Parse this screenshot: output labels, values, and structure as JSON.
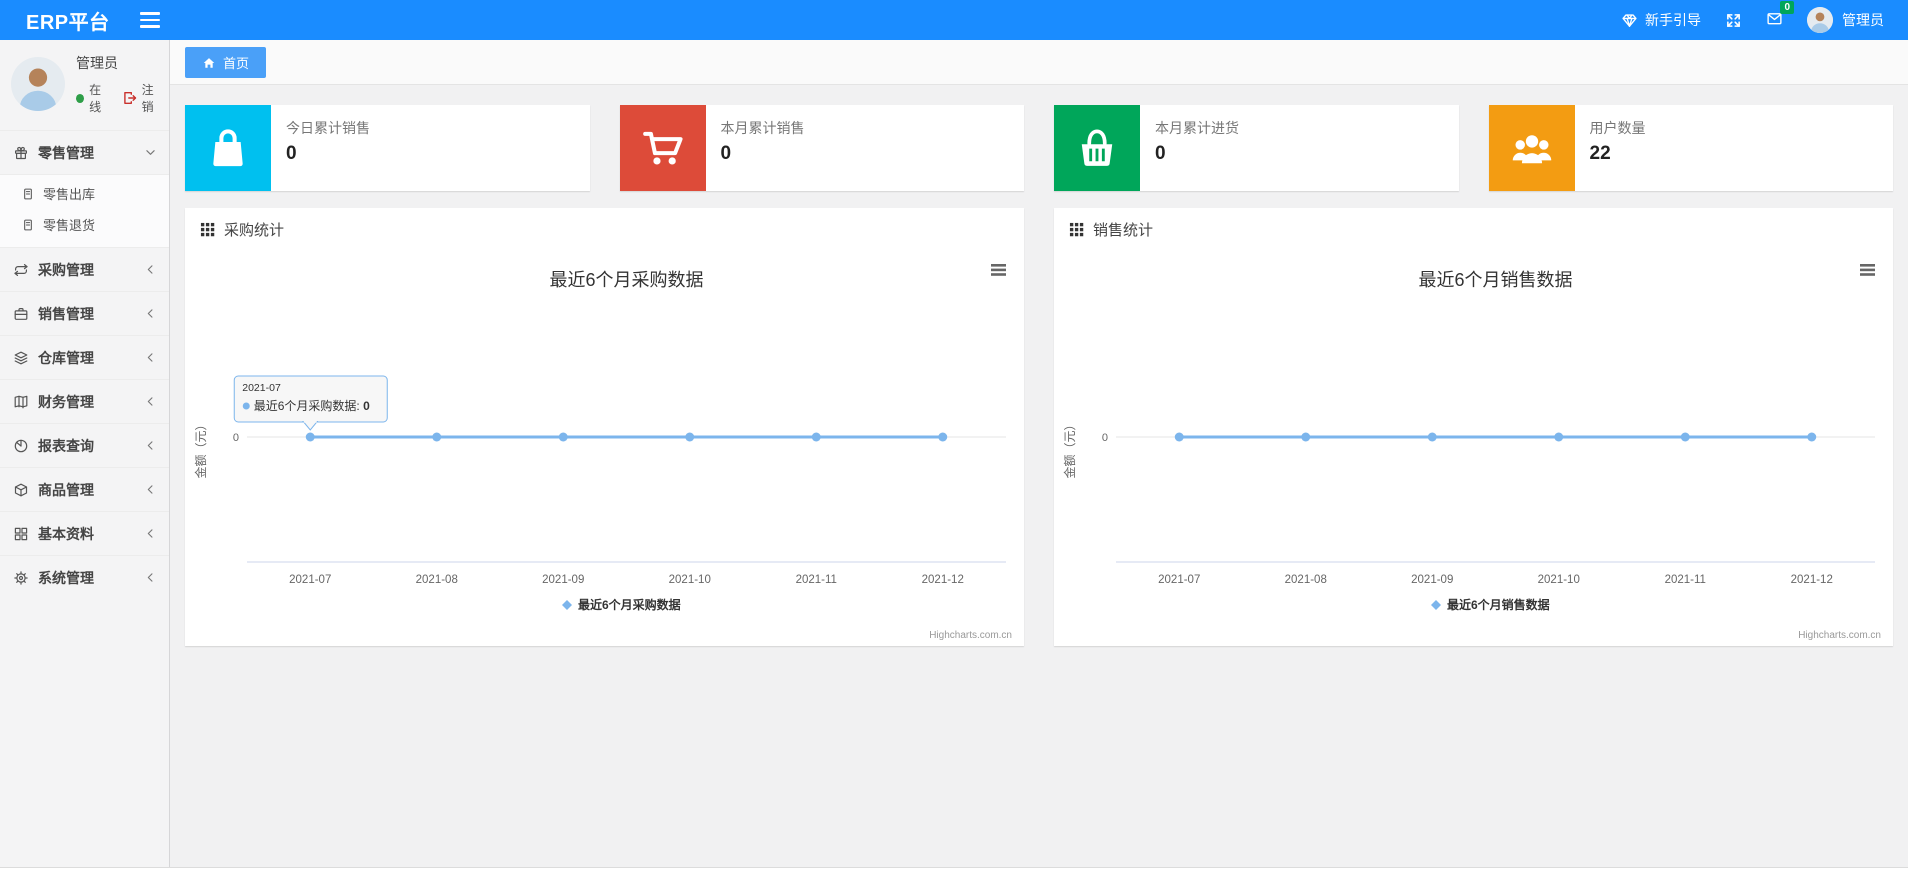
{
  "theme": {
    "navbar_blue": "#1a8cff",
    "tab_active_blue": "#4aa0f8",
    "badge_green": "#00a65a",
    "online_green": "#2e9e48",
    "logout_red": "#c9302c"
  },
  "navbar": {
    "brand": "ERP平台",
    "menu_icon": "hamburger-icon",
    "right": {
      "guide_icon": "gem-icon",
      "guide_label": "新手引导",
      "fullscreen_icon": "fullscreen-icon",
      "mail_icon": "envelope-icon",
      "mail_badge": "0",
      "avatar_icon": "avatar-icon",
      "username": "管理员"
    }
  },
  "sidebar": {
    "user": {
      "avatar_icon": "avatar-icon",
      "name": "管理员",
      "status": "在线",
      "logout_icon": "sign-out-icon",
      "logout_label": "注销"
    },
    "items": [
      {
        "label": "零售管理",
        "icon": "gift-icon",
        "chevron": "chevron-down-icon",
        "state": "expanded",
        "children": [
          {
            "label": "零售出库",
            "icon": "file-icon"
          },
          {
            "label": "零售退货",
            "icon": "file-icon"
          }
        ]
      },
      {
        "label": "采购管理",
        "icon": "exchange-icon",
        "chevron": "chevron-left-icon",
        "state": "collapsed"
      },
      {
        "label": "销售管理",
        "icon": "briefcase-icon",
        "chevron": "chevron-left-icon",
        "state": "collapsed"
      },
      {
        "label": "仓库管理",
        "icon": "layers-icon",
        "chevron": "chevron-left-icon",
        "state": "collapsed"
      },
      {
        "label": "财务管理",
        "icon": "book-icon",
        "chevron": "chevron-left-icon",
        "state": "collapsed"
      },
      {
        "label": "报表查询",
        "icon": "pie-chart-icon",
        "chevron": "chevron-left-icon",
        "state": "collapsed"
      },
      {
        "label": "商品管理",
        "icon": "cube-icon",
        "chevron": "chevron-left-icon",
        "state": "collapsed"
      },
      {
        "label": "基本资料",
        "icon": "grid-icon",
        "chevron": "chevron-left-icon",
        "state": "collapsed"
      },
      {
        "label": "系统管理",
        "icon": "gear-icon",
        "chevron": "chevron-left-icon",
        "state": "collapsed"
      }
    ]
  },
  "breadcrumb": {
    "tab_icon": "home-icon",
    "tab_label": "首页"
  },
  "stat_cards": [
    {
      "label": "今日累计销售",
      "value": "0",
      "color": "#00c0ef",
      "icon": "shopping-bag-icon"
    },
    {
      "label": "本月累计销售",
      "value": "0",
      "color": "#dd4b39",
      "icon": "shopping-cart-icon"
    },
    {
      "label": "本月累计进货",
      "value": "0",
      "color": "#00a65a",
      "icon": "shopping-basket-icon"
    },
    {
      "label": "用户数量",
      "value": "22",
      "color": "#f39c12",
      "icon": "users-icon"
    }
  ],
  "panels": [
    {
      "header": "采购统计",
      "icon": "th-grid-icon"
    },
    {
      "header": "销售统计",
      "icon": "th-grid-icon"
    }
  ],
  "chart_data": [
    {
      "type": "line",
      "title": "最近6个月采购数据",
      "categories": [
        "2021-07",
        "2021-08",
        "2021-09",
        "2021-10",
        "2021-11",
        "2021-12"
      ],
      "series": [
        {
          "name": "最近6个月采购数据",
          "values": [
            0,
            0,
            0,
            0,
            0,
            0
          ],
          "color": "#7cb5ec"
        }
      ],
      "ylabel": "金额（元）",
      "yticks": [
        "0"
      ],
      "grid": "zero-line-only",
      "legend_position": "bottom",
      "credits": "Highcharts.com.cn",
      "context_menu_icon": "context-menu-icon",
      "tooltip": {
        "header": "2021-07",
        "series": "最近6个月采购数据",
        "separator": ": ",
        "value": "0"
      }
    },
    {
      "type": "line",
      "title": "最近6个月销售数据",
      "categories": [
        "2021-07",
        "2021-08",
        "2021-09",
        "2021-10",
        "2021-11",
        "2021-12"
      ],
      "series": [
        {
          "name": "最近6个月销售数据",
          "values": [
            0,
            0,
            0,
            0,
            0,
            0
          ],
          "color": "#7cb5ec"
        }
      ],
      "ylabel": "金额（元）",
      "yticks": [
        "0"
      ],
      "grid": "zero-line-only",
      "legend_position": "bottom",
      "credits": "Highcharts.com.cn",
      "context_menu_icon": "context-menu-icon",
      "tooltip": null
    }
  ]
}
